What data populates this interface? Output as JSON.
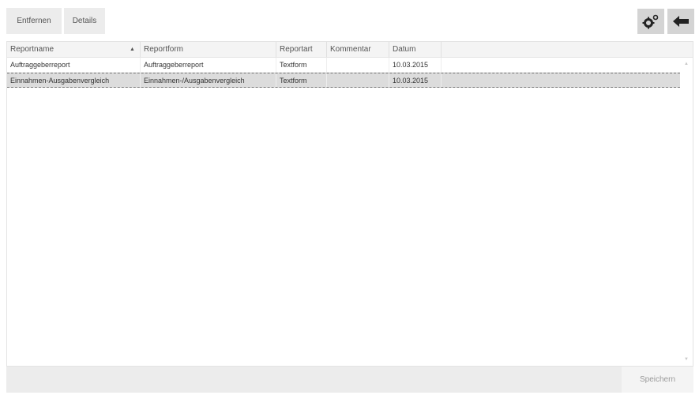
{
  "toolbar": {
    "remove_label": "Entfernen",
    "details_label": "Details",
    "settings_icon": "settings-gears-icon",
    "back_icon": "arrow-left-icon"
  },
  "table": {
    "columns": [
      "Reportname",
      "Reportform",
      "Reportart",
      "Kommentar",
      "Datum"
    ],
    "sort_column": "Reportname",
    "sort_direction": "ascending",
    "rows": [
      [
        "Auftraggeberreport",
        "Auftraggeberreport",
        "Textform",
        "",
        "10.03.2015"
      ],
      [
        "Einnahmen-Ausgabenvergleich",
        "Einnahmen-/Ausgabenvergleich",
        "Textform",
        "",
        "10.03.2015"
      ]
    ],
    "selected_row": 1
  },
  "footer": {
    "save_label": "Speichern"
  },
  "colors": {
    "button_bg": "#ececec",
    "icon_button_bg": "#d4d4d4",
    "selected_row_bg": "#dcdcdc",
    "header_bg": "#f4f4f4"
  }
}
